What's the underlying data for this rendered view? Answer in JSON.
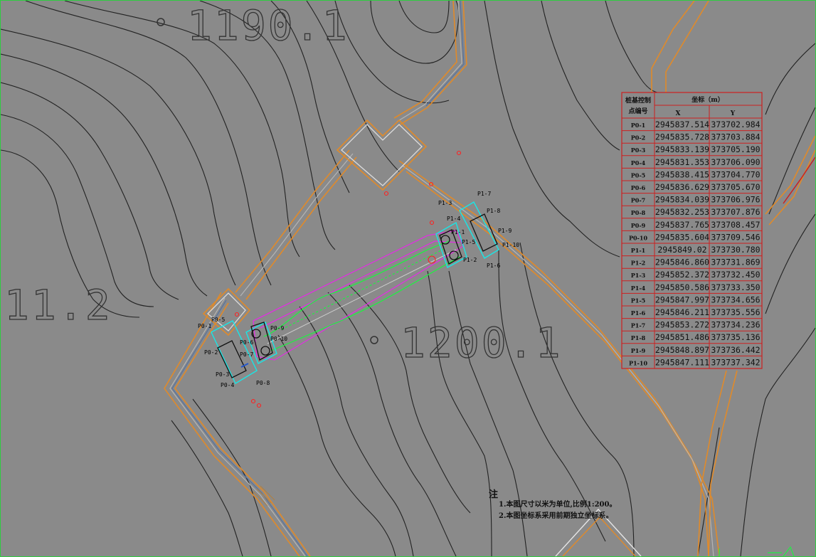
{
  "elevations": [
    "1190.1",
    "11.2",
    "1200.1"
  ],
  "point_labels": {
    "p0": [
      "P0-1",
      "P0-2",
      "P0-3",
      "P0-4",
      "P0-5",
      "P0-6",
      "P0-7",
      "P0-8",
      "P0-9",
      "P0-10"
    ],
    "p1": [
      "P1-1",
      "P1-2",
      "P1-3",
      "P1-4",
      "P1-5",
      "P1-6",
      "P1-7",
      "P1-8",
      "P1-9",
      "P1-10"
    ]
  },
  "table": {
    "header_id": [
      "桩基控制",
      "点编号"
    ],
    "header_coord": "坐标（m）",
    "header_x": "X",
    "header_y": "Y",
    "rows": [
      {
        "id": "P0-1",
        "x": "2945837.514",
        "y": "373702.984"
      },
      {
        "id": "P0-2",
        "x": "2945835.728",
        "y": "373703.884"
      },
      {
        "id": "P0-3",
        "x": "2945833.139",
        "y": "373705.190"
      },
      {
        "id": "P0-4",
        "x": "2945831.353",
        "y": "373706.090"
      },
      {
        "id": "P0-5",
        "x": "2945838.415",
        "y": "373704.770"
      },
      {
        "id": "P0-6",
        "x": "2945836.629",
        "y": "373705.670"
      },
      {
        "id": "P0-7",
        "x": "2945834.039",
        "y": "373706.976"
      },
      {
        "id": "P0-8",
        "x": "2945832.253",
        "y": "373707.876"
      },
      {
        "id": "P0-9",
        "x": "2945837.765",
        "y": "373708.457"
      },
      {
        "id": "P0-10",
        "x": "2945835.604",
        "y": "373709.546"
      },
      {
        "id": "P1-1",
        "x": "2945849.02",
        "y": "373730.780"
      },
      {
        "id": "P1-2",
        "x": "2945846.860",
        "y": "373731.869"
      },
      {
        "id": "P1-3",
        "x": "2945852.372",
        "y": "373732.450"
      },
      {
        "id": "P1-4",
        "x": "2945850.586",
        "y": "373733.350"
      },
      {
        "id": "P1-5",
        "x": "2945847.997",
        "y": "373734.656"
      },
      {
        "id": "P1-6",
        "x": "2945846.211",
        "y": "373735.556"
      },
      {
        "id": "P1-7",
        "x": "2945853.272",
        "y": "373734.236"
      },
      {
        "id": "P1-8",
        "x": "2945851.486",
        "y": "373735.136"
      },
      {
        "id": "P1-9",
        "x": "2945848.897",
        "y": "373736.442"
      },
      {
        "id": "P1-10",
        "x": "2945847.111",
        "y": "373737.342"
      }
    ]
  },
  "notes": {
    "title": "注",
    "lines": [
      "1.本图尺寸以米为单位,比例1:200。",
      "2.本图坐标系采用前期独立坐标系。"
    ]
  },
  "colors": {
    "background": "#8a8a8a",
    "contour": "#222222",
    "road_edge": "#e08a2a",
    "pile_frame": "#19e6e6",
    "bridge_edge": "#e030e0",
    "bridge_core": "#22ee44",
    "table_border": "#cc2020"
  }
}
